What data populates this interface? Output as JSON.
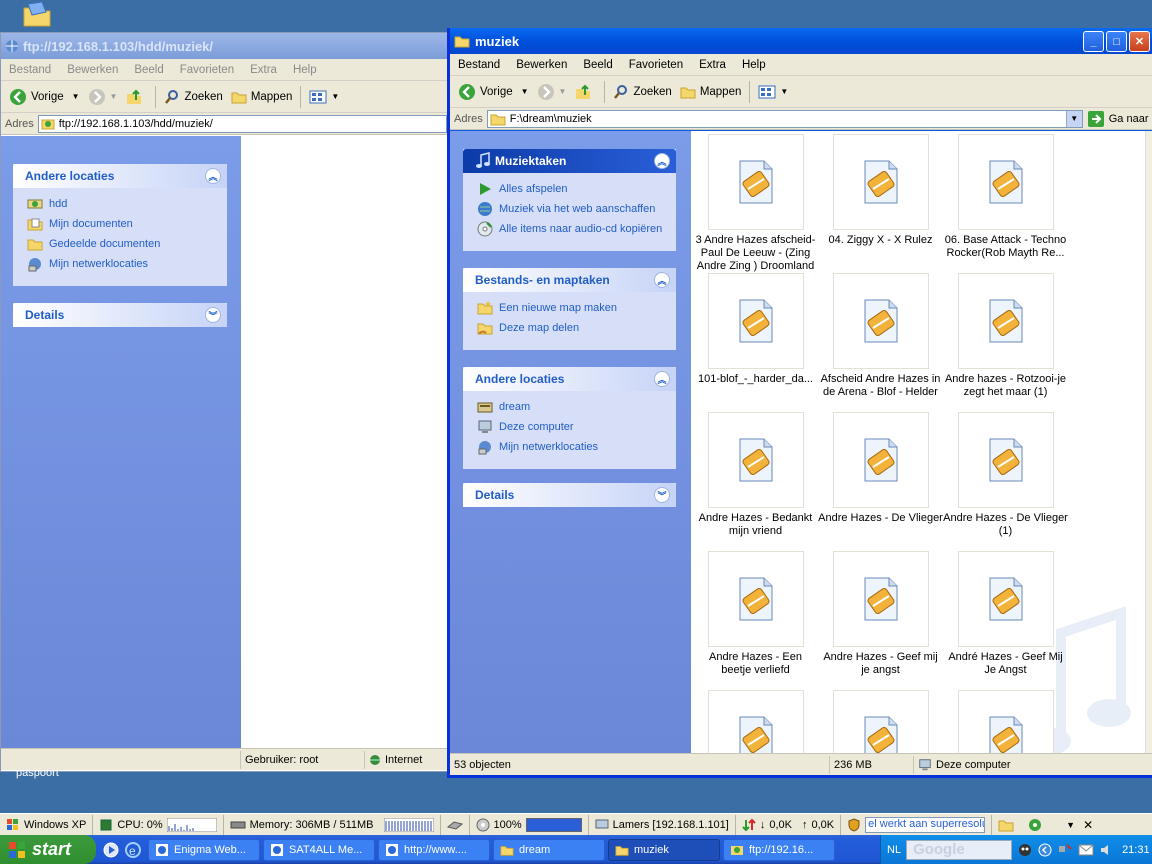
{
  "desktop": {
    "bottom_label": "paspoort"
  },
  "left_window": {
    "title": "ftp://192.168.1.103/hdd/muziek/",
    "menu": [
      "Bestand",
      "Bewerken",
      "Beeld",
      "Favorieten",
      "Extra",
      "Help"
    ],
    "toolbar": {
      "back": "Vorige",
      "search": "Zoeken",
      "folders": "Mappen"
    },
    "address": {
      "label": "Adres",
      "value": "ftp://192.168.1.103/hdd/muziek/"
    },
    "other_places": {
      "title": "Andere locaties",
      "items": [
        "hdd",
        "Mijn documenten",
        "Gedeelde documenten",
        "Mijn netwerklocaties"
      ]
    },
    "details": {
      "title": "Details"
    },
    "status": {
      "user": "Gebruiker: root",
      "zone": "Internet"
    }
  },
  "right_window": {
    "title": "muziek",
    "menu": [
      "Bestand",
      "Bewerken",
      "Beeld",
      "Favorieten",
      "Extra",
      "Help"
    ],
    "toolbar": {
      "back": "Vorige",
      "search": "Zoeken",
      "folders": "Mappen"
    },
    "address": {
      "label": "Adres",
      "value": "F:\\dream\\muziek",
      "go": "Ga naar"
    },
    "music_tasks": {
      "title": "Muziektaken",
      "items": [
        "Alles afspelen",
        "Muziek via het web aanschaffen",
        "Alle items naar audio-cd kopiëren"
      ]
    },
    "file_tasks": {
      "title": "Bestands- en maptaken",
      "items": [
        "Een nieuwe map maken",
        "Deze map delen"
      ]
    },
    "other_places": {
      "title": "Andere locaties",
      "items": [
        "dream",
        "Deze computer",
        "Mijn netwerklocaties"
      ]
    },
    "details": {
      "title": "Details"
    },
    "files": [
      "3 Andre Hazes afscheid-Paul De Leeuw - (Zing Andre Zing ) Droomland",
      "04. Ziggy X - X Rulez",
      "06. Base Attack - Techno Rocker(Rob Mayth Re...",
      "101-blof_-_harder_da...",
      "Afscheid Andre Hazes in de Arena - Blof - Helder",
      "Andre hazes  - Rotzooi-je zegt het maar (1)",
      "Andre Hazes - Bedankt mijn vriend",
      "Andre Hazes - De Vlieger",
      "Andre Hazes - De Vlieger (1)",
      "Andre Hazes - Een beetje verliefd",
      "Andre Hazes - Geef mij je angst",
      "André Hazes - Geef Mij Je Angst",
      "",
      "",
      ""
    ],
    "status": {
      "count": "53 objecten",
      "size": "236 MB",
      "location": "Deze computer"
    }
  },
  "infobar": {
    "os": "Windows XP",
    "cpu": "CPU: 0%",
    "memory": "Memory: 306MB / 511MB",
    "zoom": "100%",
    "user": "Lamers [192.168.1.101]",
    "down": "0,0K",
    "up": "0,0K",
    "search_placeholder": "el werkt aan superresolu"
  },
  "taskbar": {
    "start": "start",
    "tasks": [
      "Enigma Web...",
      "SAT4ALL Me...",
      "http://www....",
      "dream",
      "muziek",
      "ftp://192.16..."
    ],
    "active_task": "muziek",
    "lang": "NL",
    "search_logo": "Google",
    "clock": "21:31"
  },
  "colors": {
    "xp_blue": "#0a5adf",
    "task_link": "#215dc6",
    "start_green": "#3c9a3c"
  }
}
